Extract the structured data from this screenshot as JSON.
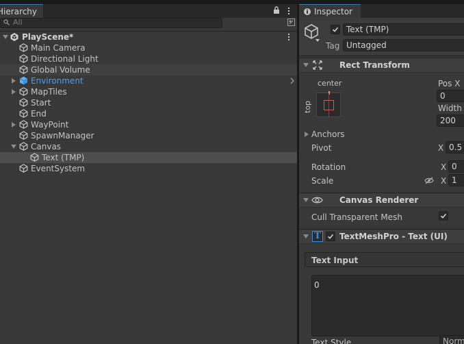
{
  "hierarchy": {
    "tab_label": "Hierarchy",
    "search_placeholder": "All",
    "scene_name": "PlayScene*",
    "items": [
      {
        "label": "Main Camera",
        "icon": "gameobject-cube-icon",
        "expandable": false
      },
      {
        "label": "Directional Light",
        "icon": "gameobject-cube-icon",
        "expandable": false
      },
      {
        "label": "Global Volume",
        "icon": "gameobject-cube-icon",
        "expandable": false
      },
      {
        "label": "Environment",
        "icon": "prefab-cube-icon",
        "expandable": true,
        "prefab": true
      },
      {
        "label": "MapTiles",
        "icon": "gameobject-cube-icon",
        "expandable": true
      },
      {
        "label": "Start",
        "icon": "gameobject-cube-icon",
        "expandable": false
      },
      {
        "label": "End",
        "icon": "gameobject-cube-icon",
        "expandable": false
      },
      {
        "label": "WayPoint",
        "icon": "gameobject-cube-icon",
        "expandable": true
      },
      {
        "label": "SpawnManager",
        "icon": "gameobject-cube-icon",
        "expandable": false
      },
      {
        "label": "Canvas",
        "icon": "gameobject-cube-icon",
        "expandable": true,
        "expanded": true
      },
      {
        "label": "Text (TMP)",
        "icon": "gameobject-cube-icon",
        "expandable": false,
        "selected": true,
        "child": true
      },
      {
        "label": "EventSystem",
        "icon": "gameobject-cube-icon",
        "expandable": false
      }
    ]
  },
  "inspector": {
    "tab_label": "Inspector",
    "object_name": "Text (TMP)",
    "object_active": true,
    "tag_label": "Tag",
    "tag_value": "Untagged",
    "rect_transform": {
      "title": "Rect Transform",
      "anchor_h": "center",
      "anchor_v": "top",
      "pos_x_label": "Pos X",
      "pos_x_value": "0",
      "width_label": "Width",
      "width_value": "200",
      "anchors_label": "Anchors",
      "pivot_label": "Pivot",
      "pivot_x_label": "X",
      "pivot_x_value": "0.5",
      "rotation_label": "Rotation",
      "rotation_x_label": "X",
      "rotation_x_value": "0",
      "scale_label": "Scale",
      "scale_x_label": "X",
      "scale_x_value": "1"
    },
    "canvas_renderer": {
      "title": "Canvas Renderer",
      "cull_label": "Cull Transparent Mesh",
      "cull_checked": true
    },
    "tmp": {
      "title": "TextMeshPro - Text (UI)",
      "enabled": true,
      "text_input_label": "Text Input",
      "text_value": "0",
      "text_style_label": "Text Style",
      "text_style_value": "Normal"
    }
  },
  "colors": {
    "panel_bg": "#383838",
    "tab_bar_bg": "#282828",
    "selection": "#4d4d4d",
    "prefab_blue": "#4e9ee9",
    "tmp_icon_blue": "#3a8bd8"
  }
}
